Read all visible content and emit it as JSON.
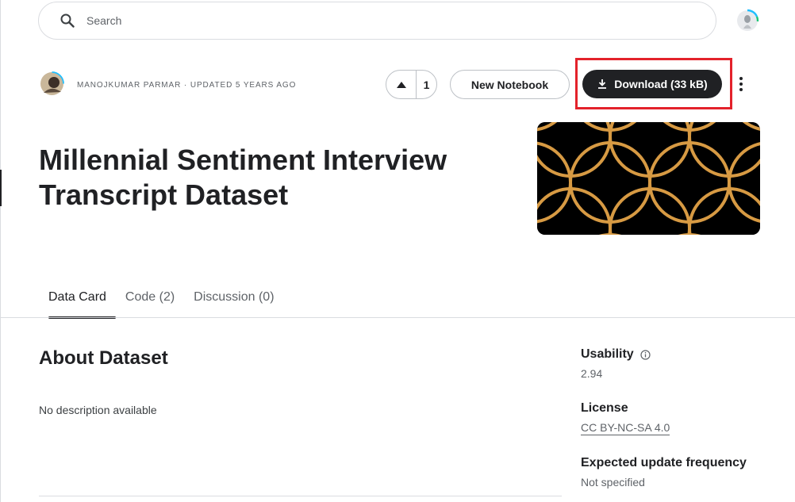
{
  "search": {
    "placeholder": "Search",
    "icon": "search-icon"
  },
  "header": {
    "author": "MANOJKUMAR PARMAR",
    "separator": "·",
    "updated": "UPDATED 5 YEARS AGO",
    "vote_count": "1",
    "new_notebook_label": "New Notebook",
    "download_label": "Download (33 kB)",
    "highlight_color": "#e3222b"
  },
  "dataset": {
    "title": "Millennial Sentiment Interview Transcript Dataset",
    "cover_colors": {
      "background": "#000000",
      "pattern": "#d79a43"
    }
  },
  "tabs": [
    {
      "label": "Data Card",
      "active": true
    },
    {
      "label": "Code (2)",
      "active": false
    },
    {
      "label": "Discussion (0)",
      "active": false
    }
  ],
  "about": {
    "heading": "About Dataset",
    "description": "No description available"
  },
  "sidebar": {
    "usability_label": "Usability",
    "usability_value": "2.94",
    "license_label": "License",
    "license_value": "CC BY-NC-SA 4.0",
    "frequency_label": "Expected update frequency",
    "frequency_value": "Not specified"
  }
}
